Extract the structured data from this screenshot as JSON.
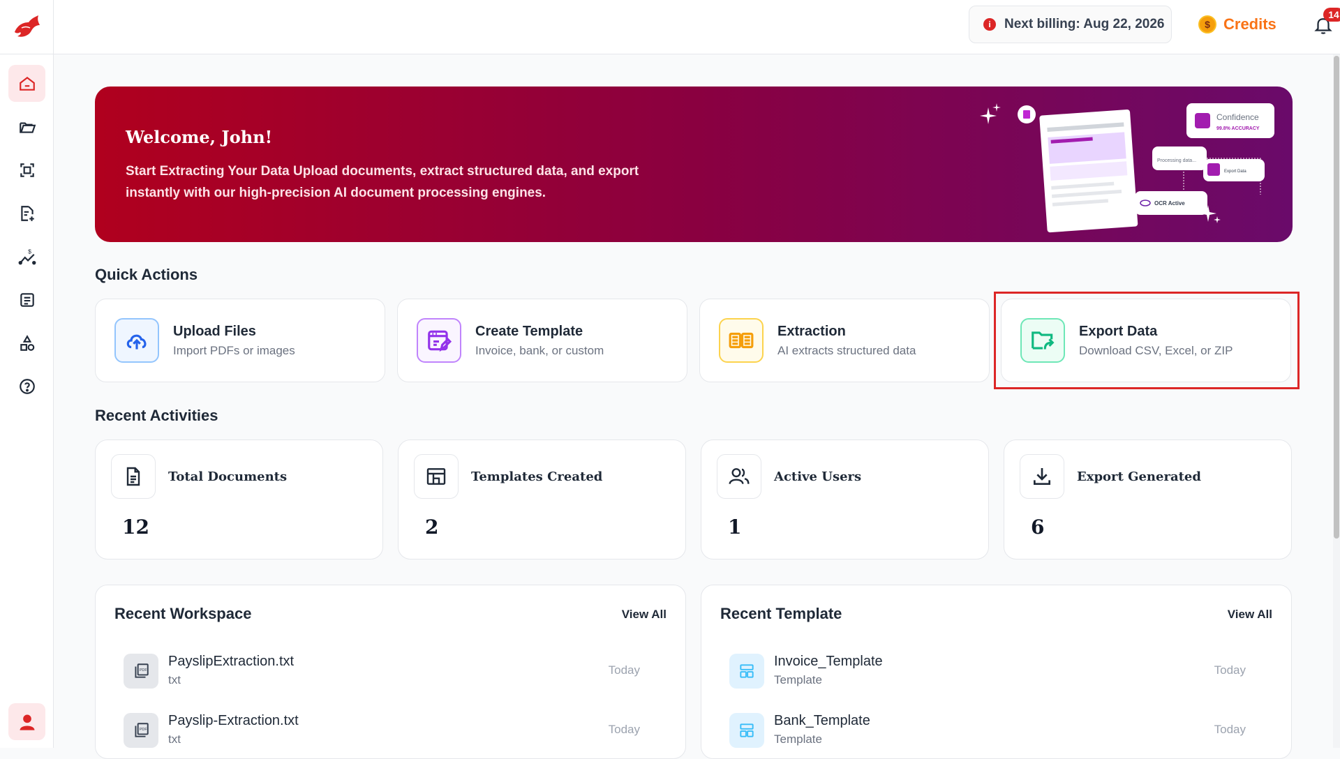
{
  "topbar": {
    "billing": "Next billing: Aug 22, 2026",
    "credits": "Credits",
    "notifications": "14"
  },
  "banner": {
    "title": "Welcome, John!",
    "text": "Start Extracting Your Data Upload documents, extract structured data, and export instantly with our high-precision AI document processing engines.",
    "art": {
      "confidence": "Confidence",
      "accuracy": "99.8% ACCURACY",
      "processing": "Processing data...",
      "export": "Export Data",
      "ocr": "OCR Active"
    }
  },
  "quick_actions": {
    "title": "Quick Actions",
    "items": [
      {
        "title": "Upload Files",
        "sub": "Import PDFs or images"
      },
      {
        "title": "Create Template",
        "sub": "Invoice, bank, or custom"
      },
      {
        "title": "Extraction",
        "sub": "AI extracts structured data"
      },
      {
        "title": "Export Data",
        "sub": "Download CSV, Excel, or ZIP"
      }
    ]
  },
  "recent_activities": {
    "title": "Recent Activities",
    "stats": [
      {
        "label": "Total Documents",
        "value": "12"
      },
      {
        "label": "Templates Created",
        "value": "2"
      },
      {
        "label": "Active Users",
        "value": "1"
      },
      {
        "label": "Export Generated",
        "value": "6"
      }
    ]
  },
  "workspace": {
    "title": "Recent Workspace",
    "view_all": "View All",
    "rows": [
      {
        "name": "PayslipExtraction.txt",
        "type": "txt",
        "date": "Today"
      },
      {
        "name": "Payslip-Extraction.txt",
        "type": "txt",
        "date": "Today"
      }
    ]
  },
  "templates": {
    "title": "Recent Template",
    "view_all": "View All",
    "rows": [
      {
        "name": "Invoice_Template",
        "type": "Template",
        "date": "Today"
      },
      {
        "name": "Bank_Template",
        "type": "Template",
        "date": "Today"
      }
    ]
  },
  "colors": {
    "accent": "#dc2626",
    "credits": "#f97316",
    "upload": "#2563eb",
    "template": "#9333ea",
    "extraction": "#f59e0b",
    "export": "#10b981"
  }
}
